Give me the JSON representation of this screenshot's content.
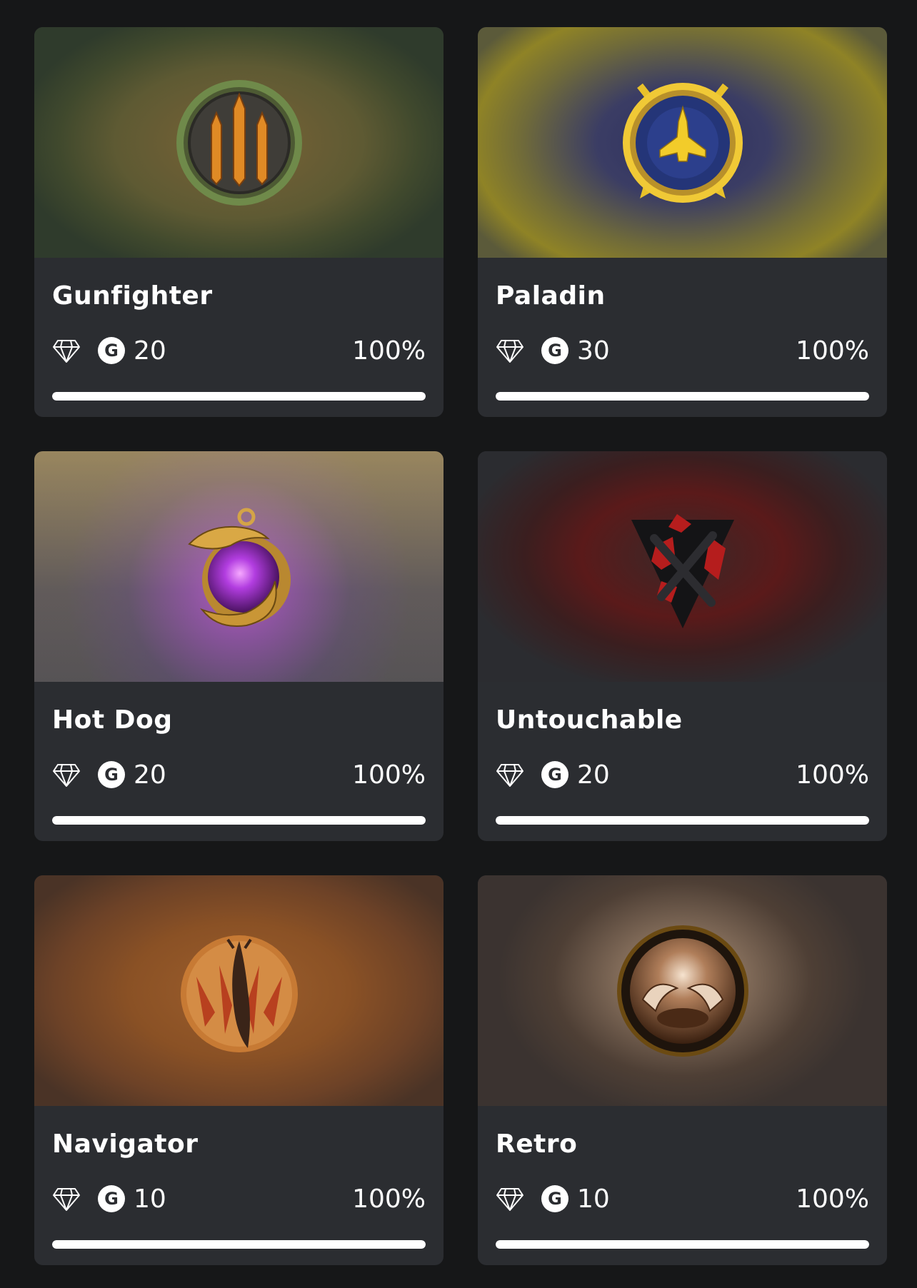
{
  "cards": [
    {
      "title": "Gunfighter",
      "gamerscore": "20",
      "progress_label": "100%",
      "progress": 1.0,
      "emblem": "missiles-badge-icon"
    },
    {
      "title": "Paladin",
      "gamerscore": "30",
      "progress_label": "100%",
      "progress": 1.0,
      "emblem": "spaceship-badge-icon"
    },
    {
      "title": "Hot Dog",
      "gamerscore": "20",
      "progress_label": "100%",
      "progress": 1.0,
      "emblem": "eagle-orb-icon"
    },
    {
      "title": "Untouchable",
      "gamerscore": "20",
      "progress_label": "100%",
      "progress": 1.0,
      "emblem": "red-glyph-icon"
    },
    {
      "title": "Navigator",
      "gamerscore": "10",
      "progress_label": "100%",
      "progress": 1.0,
      "emblem": "insect-badge-icon"
    },
    {
      "title": "Retro",
      "gamerscore": "10",
      "progress_label": "100%",
      "progress": 1.0,
      "emblem": "bronze-medallion-icon"
    }
  ],
  "icons": {
    "rarity": "diamond-icon",
    "gamerscore": "gamerscore-icon"
  },
  "gamerscore_glyph": "G",
  "colors": {
    "page_bg": "#161718",
    "card_bg": "#2b2d31",
    "bar_fill": "#ffffff",
    "bar_track": "#4a4c52"
  }
}
